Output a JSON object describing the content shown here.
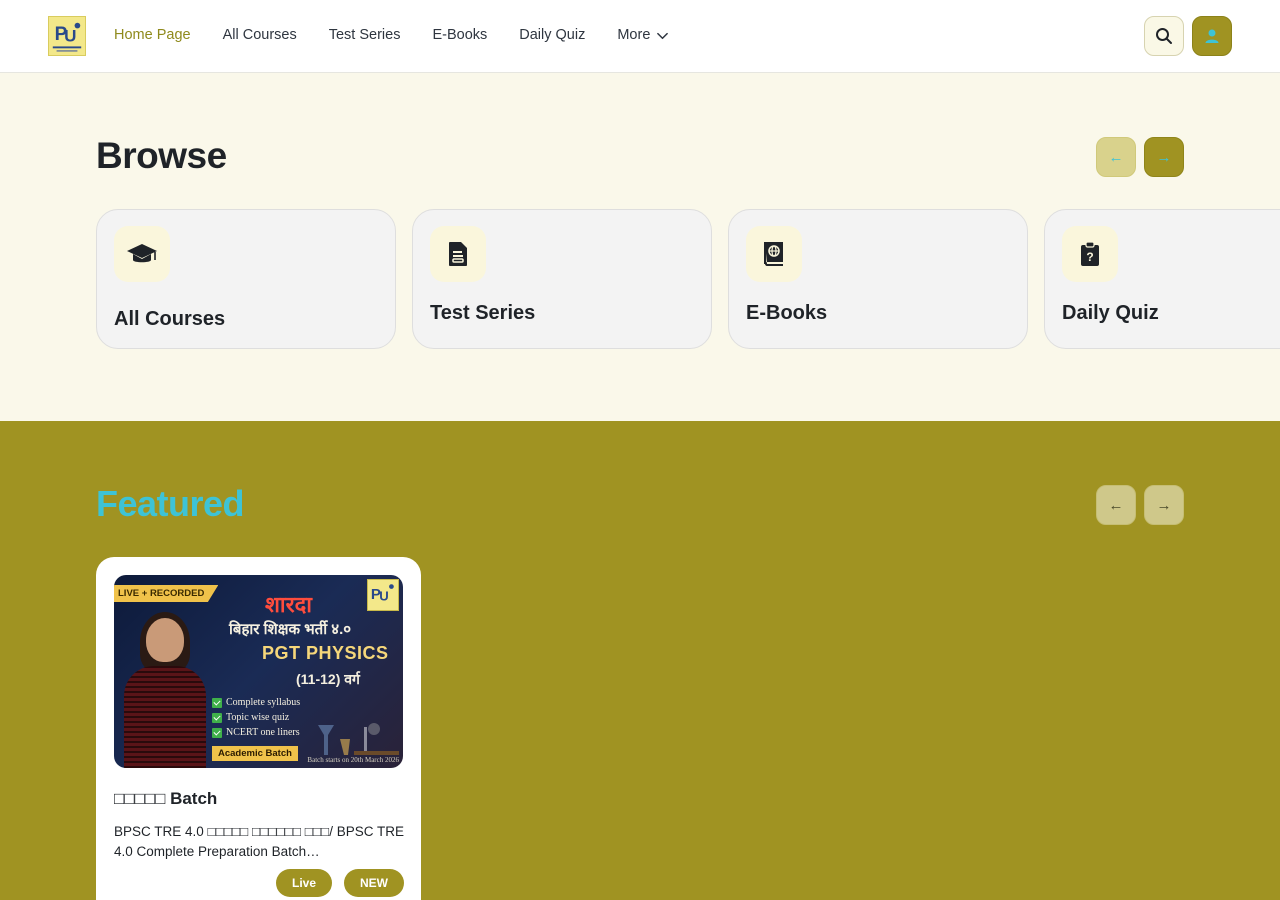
{
  "header": {
    "logo_icon": "brand-logo-icon",
    "nav": [
      {
        "label": "Home Page",
        "active": true
      },
      {
        "label": "All Courses"
      },
      {
        "label": "Test Series"
      },
      {
        "label": "E-Books"
      },
      {
        "label": "Daily Quiz"
      },
      {
        "label": "More"
      }
    ],
    "search_icon": "search-icon",
    "user_icon": "user-icon"
  },
  "browse": {
    "title": "Browse",
    "prev_arrow": "←",
    "next_arrow": "→",
    "categories": [
      {
        "label": "All Courses",
        "icon": "graduation-cap-icon"
      },
      {
        "label": "Test Series",
        "icon": "document-icon"
      },
      {
        "label": "E-Books",
        "icon": "book-icon"
      },
      {
        "label": "Daily Quiz",
        "icon": "quiz-clipboard-icon"
      }
    ]
  },
  "featured": {
    "title": "Featured",
    "prev_arrow": "←",
    "next_arrow": "→",
    "courses": [
      {
        "banner": {
          "tag": "LIVE + RECORDED",
          "line1": "शारदा",
          "line2": "बिहार शिक्षक भर्ती ४.०",
          "line3": "PGT PHYSICS",
          "line4": "(11-12) वर्ग",
          "features": [
            "Complete syllabus",
            "Topic wise quiz",
            "NCERT one liners"
          ],
          "batch_label": "Academic Batch",
          "start_note": "Batch starts on 20th March 2026"
        },
        "title": "□□□□□ Batch",
        "description": "BPSC TRE 4.0 □□□□□ □□□□□□ □□□/ BPSC TRE 4.0 Complete Preparation Batch…",
        "badges": [
          "Live",
          "NEW"
        ]
      }
    ]
  },
  "colors": {
    "accent": "#a09322",
    "accent_light": "#d9d28c",
    "highlight_cyan": "#3ec3d6",
    "browse_bg": "#faf8ea",
    "card_bg": "#f3f3f3"
  }
}
